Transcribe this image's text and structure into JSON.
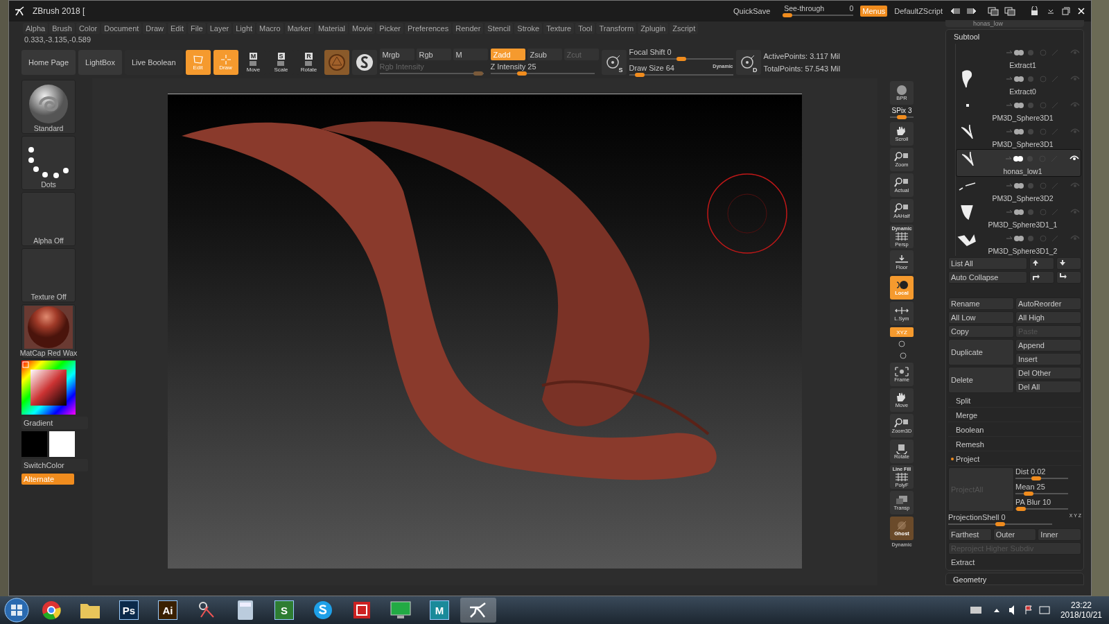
{
  "window": {
    "title": "ZBrush 2018 ["
  },
  "title_bar": {
    "quicksave": "QuickSave",
    "see_through": {
      "label": "See-through",
      "value": "0",
      "level": 0.05
    },
    "menus": {
      "label": "Menus",
      "on": true
    },
    "script": "DefaultZScript"
  },
  "menu_bar": [
    "Alpha",
    "Brush",
    "Color",
    "Document",
    "Draw",
    "Edit",
    "File",
    "Layer",
    "Light",
    "Macro",
    "Marker",
    "Material",
    "Movie",
    "Picker",
    "Preferences",
    "Render",
    "Stencil",
    "Stroke",
    "Texture",
    "Tool",
    "Transform",
    "Zplugin",
    "Zscript"
  ],
  "coordinates": "0.333,-3.135,-0.589",
  "top_shelf": {
    "nav_buttons": [
      "Home Page",
      "LightBox",
      "Live Boolean"
    ],
    "tools": [
      {
        "kind": "edit",
        "label": "Edit",
        "selected": true
      },
      {
        "kind": "draw",
        "label": "Draw",
        "selected": true
      },
      {
        "kind": "move",
        "label": "Move",
        "key": "M",
        "selected": false
      },
      {
        "kind": "scale",
        "label": "Scale",
        "key": "S",
        "selected": false
      },
      {
        "kind": "rotate",
        "label": "Rotate",
        "key": "R",
        "selected": false
      }
    ],
    "color_modes": [
      {
        "label": "Mrgb",
        "selected": false
      },
      {
        "label": "Rgb",
        "selected": false
      },
      {
        "label": "M",
        "selected": false
      }
    ],
    "rgb_intensity": {
      "label": "Rgb Intensity",
      "disabled": true,
      "level": 0.95
    },
    "z_modes": [
      {
        "label": "Zadd",
        "selected": true,
        "disabled": false
      },
      {
        "label": "Zsub",
        "selected": false,
        "disabled": false
      },
      {
        "label": "Zcut",
        "selected": false,
        "disabled": true
      }
    ],
    "z_intensity": {
      "label": "Z Intensity",
      "value": "25",
      "level": 0.3
    },
    "focal_key": "S",
    "focal_shift": {
      "label": "Focal Shift",
      "value": "0",
      "level": 0.5
    },
    "draw_size": {
      "label": "Draw Size",
      "value": "64",
      "level": 0.1
    },
    "dynamic": "Dynamic",
    "lazy_key": "D",
    "stats": [
      "ActivePoints: 3.117 Mil",
      "TotalPoints: 57.543 Mil"
    ]
  },
  "left_panel": {
    "thumbs": [
      {
        "kind": "brush",
        "label": "Standard"
      },
      {
        "kind": "dots",
        "label": "Dots"
      },
      {
        "kind": "empty",
        "label": "Alpha Off"
      },
      {
        "kind": "empty",
        "label": "Texture Off"
      },
      {
        "kind": "matcap",
        "label": "MatCap Red Wax"
      }
    ],
    "gradient": "Gradient",
    "switch_color": "SwitchColor",
    "alternate": {
      "label": "Alternate",
      "on": true
    }
  },
  "right_shelf": [
    {
      "kind": "sphere",
      "label": "BPR",
      "on": false
    },
    {
      "kind": "slider",
      "label": "SPix",
      "value": "3",
      "level": 0.5
    },
    {
      "kind": "hand",
      "label": "Scroll",
      "on": false
    },
    {
      "kind": "magnifier",
      "label": "Zoom",
      "on": false
    },
    {
      "kind": "magnifier",
      "label": "Actual",
      "on": false
    },
    {
      "kind": "magnifier",
      "label": "AAHalf",
      "on": false
    },
    {
      "kind": "grid",
      "top": "Dynamic",
      "label": "Persp",
      "on": false
    },
    {
      "kind": "floor",
      "label": "Floor",
      "on": false
    },
    {
      "kind": "local",
      "label": "Local",
      "on": true
    },
    {
      "kind": "sym",
      "label": "L.Sym",
      "on": false
    },
    {
      "kind": "pill",
      "label": "XYZ",
      "on": true
    },
    {
      "kind": "frame",
      "label": "Frame",
      "on": false
    },
    {
      "kind": "hand",
      "label": "Move",
      "on": false
    },
    {
      "kind": "magnifier",
      "label": "Zoom3D",
      "on": false
    },
    {
      "kind": "rotate",
      "label": "Rotate",
      "on": false
    },
    {
      "kind": "grid",
      "top": "Line Fill",
      "label": "PolyF",
      "on": false
    },
    {
      "kind": "transp",
      "label": "Transp",
      "on": false
    },
    {
      "kind": "ghost",
      "label": "Ghost",
      "on": true
    },
    {
      "kind": "cut",
      "label": "Dynamic"
    }
  ],
  "subtool": {
    "above": "honas_low",
    "title": "Subtool",
    "items": [
      {
        "name": "Extract1",
        "kind": "none",
        "selected": false,
        "visible": false
      },
      {
        "name": "Extract0",
        "kind": "skull",
        "selected": false,
        "visible": false
      },
      {
        "name": "PM3D_Sphere3D1",
        "kind": "dot",
        "selected": false,
        "visible": false
      },
      {
        "name": "PM3D_Sphere3D1",
        "kind": "horns",
        "selected": false,
        "visible": false
      },
      {
        "name": "honas_low1",
        "kind": "horns",
        "selected": true,
        "visible": true
      },
      {
        "name": "PM3D_Sphere3D2",
        "kind": "stroke",
        "selected": false,
        "visible": false
      },
      {
        "name": "PM3D_Sphere3D1_1",
        "kind": "vee",
        "selected": false,
        "visible": false
      },
      {
        "name": "PM3D_Sphere3D1_2",
        "kind": "claw",
        "selected": false,
        "visible": false
      }
    ],
    "list_all": "List All",
    "auto_collapse": "Auto Collapse",
    "grid": [
      {
        "left": "Rename",
        "right": [
          "AutoReorder"
        ]
      },
      {
        "left": "All Low",
        "right": [
          "All High"
        ]
      },
      {
        "left": "Copy",
        "right": [
          "Paste"
        ],
        "right_disabled": true
      },
      {
        "left": "Duplicate",
        "right": [
          "Append",
          "Insert"
        ]
      },
      {
        "left": "Delete",
        "right": [
          "Del Other",
          "Del All"
        ]
      }
    ],
    "sections": [
      {
        "label": "Split",
        "expanded": false
      },
      {
        "label": "Merge",
        "expanded": false
      },
      {
        "label": "Boolean",
        "expanded": false
      },
      {
        "label": "Remesh",
        "expanded": false
      },
      {
        "label": "Project",
        "expanded": true
      }
    ],
    "project": {
      "project_all": "ProjectAll",
      "sliders": [
        {
          "label": "Dist",
          "value": "0.02",
          "level": 0.4
        },
        {
          "label": "Mean",
          "value": "25",
          "level": 0.25
        },
        {
          "label": "PA Blur",
          "value": "10",
          "level": 0.1
        }
      ],
      "shell": {
        "label": "ProjectionShell",
        "value": "0",
        "level": 0.5
      },
      "axes": "X Y Z",
      "modes": [
        "Farthest",
        "Outer",
        "Inner"
      ],
      "reproject": "Reproject Higher Subdiv"
    },
    "extract": "Extract",
    "next_section": "Geometry"
  },
  "taskbar": {
    "apps": [
      {
        "kind": "chrome"
      },
      {
        "kind": "folder"
      },
      {
        "kind": "tile",
        "label": "Ps",
        "color": "#0b2a4a"
      },
      {
        "kind": "tile",
        "label": "Ai",
        "color": "#3a2000"
      },
      {
        "kind": "paint"
      },
      {
        "kind": "calc"
      },
      {
        "kind": "tile",
        "label": "S",
        "color": "#2e7d32"
      },
      {
        "kind": "skype"
      },
      {
        "kind": "redsquare"
      },
      {
        "kind": "monitor"
      },
      {
        "kind": "tile",
        "label": "M",
        "color": "#1a8a9a"
      },
      {
        "kind": "zbrush"
      }
    ],
    "time": "23:22",
    "date": "2018/10/21"
  }
}
